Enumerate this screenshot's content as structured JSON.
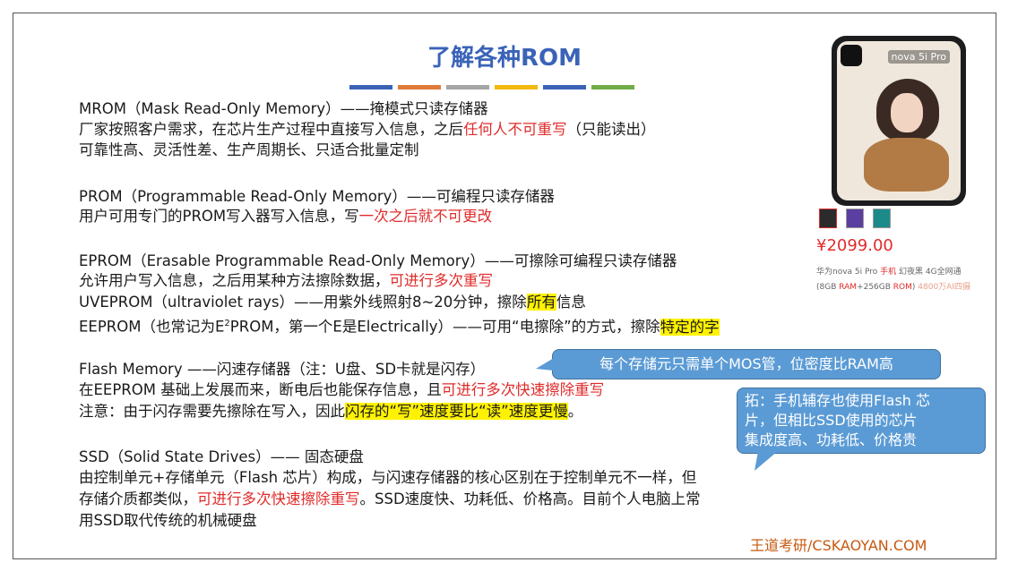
{
  "title": "了解各种ROM",
  "colors": {
    "title": "#3a63b8",
    "red": "#e02b2b",
    "highlight": "#fff200",
    "callout": "#5b9bd5",
    "bars": [
      "#3a63b8",
      "#e07b39",
      "#a5a5a5",
      "#f2b90f",
      "#3a63b8",
      "#70ad47"
    ]
  },
  "mrom": {
    "heading": "MROM（Mask Read-Only Memory）——掩模式只读存储器",
    "line1_a": "厂家按照客户需求，在芯片生产过程中直接写入信息，之后",
    "line1_red": "任何人不可重写",
    "line1_b": "（只能读出）",
    "line2": "可靠性高、灵活性差、生产周期长、只适合批量定制"
  },
  "prom": {
    "heading": "PROM（Programmable Read-Only Memory）——可编程只读存储器",
    "line1_a": "用户可用专门的PROM写入器写入信息，写",
    "line1_red": "一次之后就不可更改"
  },
  "eprom": {
    "heading": "EPROM（Erasable Programmable Read-Only Memory）——可擦除可编程只读存储器",
    "line1_a": "允许用户写入信息，之后用某种方法擦除数据，",
    "line1_red": "可进行多次重写",
    "uv_a": "UVEPROM（ultraviolet rays）——用紫外线照射8~20分钟，擦除",
    "uv_hl": "所有",
    "uv_b": "信息",
    "ee_a": "EEPROM（也常记为E",
    "ee_sup": "2",
    "ee_b": "PROM，第一个E是Electrically）——可用“电擦除”的方式，擦除",
    "ee_hl": "特定的字"
  },
  "flash": {
    "heading": "Flash Memory ——闪速存储器（注：U盘、SD卡就是闪存）",
    "line1_a": "在EEPROM 基础上发展而来，断电后也能保存信息，且",
    "line1_red": "可进行多次快速擦除重写",
    "line2_a": "注意：由于闪存需要先擦除在写入，因此",
    "line2_hl": "闪存的“写”速度要比“读”速度更慢",
    "line2_b": "。"
  },
  "ssd": {
    "heading": "SSD（Solid State Drives）—— 固态硬盘",
    "line1": "由控制单元+存储单元（Flash 芯片）构成，与闪速存储器的核心区别在于控制单元不一样，但",
    "line2_a": "存储介质都类似，",
    "line2_red": "可进行多次快速擦除重写",
    "line2_b": "。SSD速度快、功耗低、价格高。目前个人电脑上常",
    "line3": "用SSD取代传统的机械硬盘"
  },
  "callout1": "每个存储元只需单个MOS管，位密度比RAM高",
  "callout2": {
    "l1": "拓：手机辅存也使用Flash 芯",
    "l2": "片，但相比SSD使用的芯片",
    "l3": "集成度高、功耗低、价格贵"
  },
  "product": {
    "phone_label": "nova 5i Pro",
    "price": "¥2099.00",
    "desc1_a": "华为nova 5i Pro ",
    "desc1_red": "手机",
    "desc1_b": " 幻夜黑 4G全网通",
    "desc2_a": "(8GB ",
    "desc2_red1": "RAM",
    "desc2_b": "+256GB ",
    "desc2_red2": "ROM",
    "desc2_c": ") ",
    "desc2_tail": "4800万AI四摄"
  },
  "footer": "王道考研/CSKAOYAN.COM"
}
